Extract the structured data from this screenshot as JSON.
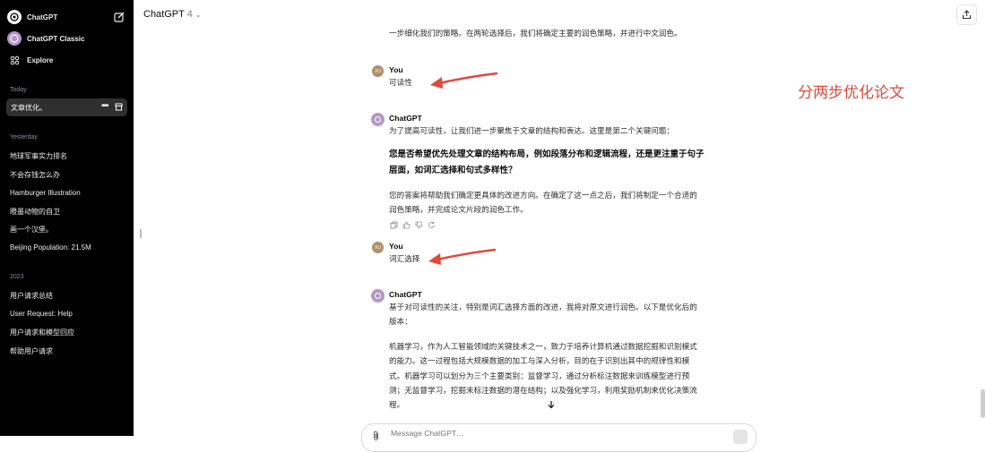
{
  "sidebar": {
    "top": [
      {
        "label": "ChatGPT"
      },
      {
        "label": "ChatGPT Classic"
      },
      {
        "label": "Explore"
      }
    ],
    "sections": [
      {
        "title": "Today",
        "items": [
          "文章优化。"
        ]
      },
      {
        "title": "Yesterday",
        "items": [
          "地球军事实力排名",
          "不会存钱怎么办",
          "Hamburger Illustration",
          "瞪墨动物的自卫",
          "画一个汉堡。",
          "Beijing Population: 21.5M"
        ]
      },
      {
        "title": "2023",
        "items": [
          "用户请求总结",
          "User Request: Help",
          "用户请求和模型回应",
          "帮助用户请求"
        ]
      }
    ]
  },
  "header": {
    "title": "ChatGPT",
    "version": "4"
  },
  "conversation": {
    "intro_text": "一步细化我们的策略。在两轮选择后，我们将确定主要的润色策略，并进行中文润色。",
    "messages": [
      {
        "author": "You",
        "avatar": "XU",
        "text": "可读性"
      },
      {
        "author": "ChatGPT",
        "paragraphs": [
          "为了提高可读性，让我们进一步聚焦于文章的结构和表达。这里是第二个关键问题：",
          "您是否希望优先处理文章的结构布局，例如段落分布和逻辑流程，还是更注重于句子层面，如词汇选择和句式多样性？",
          "您的答案将帮助我们确定更具体的改进方向。在确定了这一点之后，我们将制定一个合适的润色策略，并完成论文片段的润色工作。"
        ]
      },
      {
        "author": "You",
        "avatar": "XU",
        "text": "词汇选择"
      },
      {
        "author": "ChatGPT",
        "paragraphs": [
          "基于对可读性的关注，特别是词汇选择方面的改进，我将对原文进行润色。以下是优化后的版本：",
          "机器学习，作为人工智能领域的关键技术之一，致力于培养计算机通过数据挖掘和识别模式的能力。这一过程包括大规模数据的加工与深入分析，目的在于识别出其中的规律性和模式。机器学习可以划分为三个主要类别：监督学习，通过分析标注数据来训练模型进行预测；无监督学习，挖掘未标注数据的潜在结构；以及强化学习，利用奖励机制来优化决策流程。"
        ]
      }
    ]
  },
  "annotation": "分两步优化论文",
  "composer": {
    "placeholder": "Message ChatGPT…"
  },
  "colors": {
    "sidebar_bg": "#000000",
    "annotation": "#e0493b",
    "gpt_avatar": "#b597c6"
  },
  "icons": [
    "chatgpt-logo-icon",
    "new-chat-icon",
    "explore-icon",
    "archive-icon",
    "share-icon",
    "copy-icon",
    "thumbs-up-icon",
    "thumbs-down-icon",
    "regenerate-icon",
    "arrow-down-icon",
    "attach-icon"
  ]
}
